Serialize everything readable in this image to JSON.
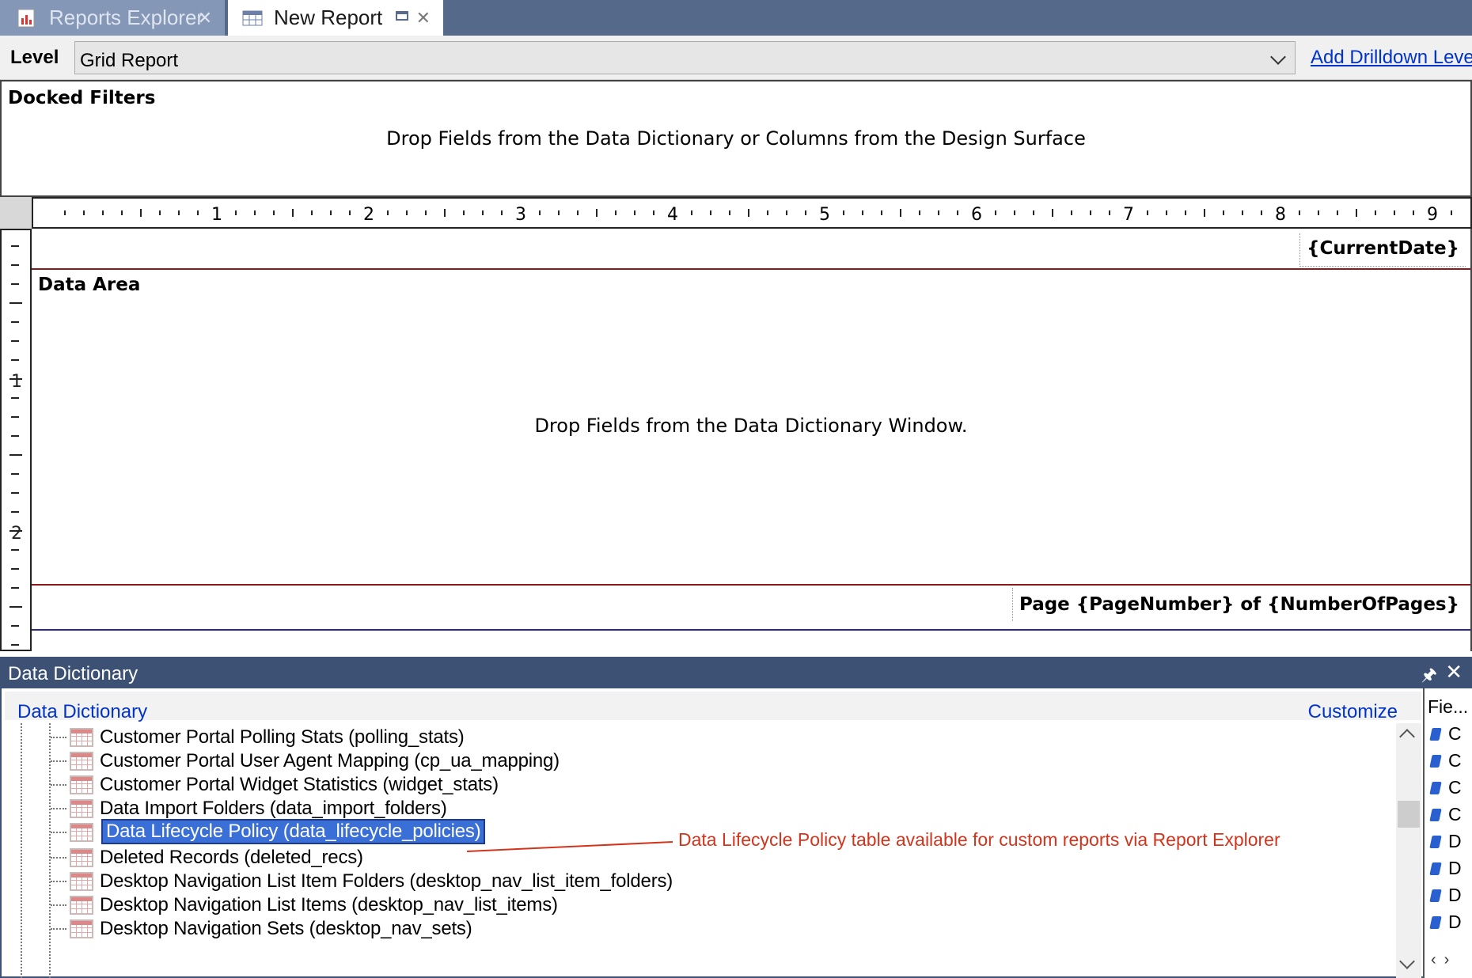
{
  "tabs": [
    {
      "label": "Reports Explorer",
      "active": false
    },
    {
      "label": "New Report",
      "active": true
    }
  ],
  "level_bar": {
    "label": "Level",
    "selected": "Grid Report",
    "add_drilldown": "Add Drilldown Level"
  },
  "docked_filters": {
    "title": "Docked Filters",
    "hint": "Drop Fields from the Data Dictionary or Columns from the Design Surface"
  },
  "ruler": {
    "horizontal": [
      "1",
      "2",
      "3",
      "4",
      "5",
      "6",
      "7",
      "8",
      "9"
    ],
    "vertical": [
      "1",
      "2"
    ]
  },
  "design_surface": {
    "current_date": "{CurrentDate}",
    "data_area_title": "Data Area",
    "data_area_hint": "Drop Fields from the Data Dictionary Window.",
    "page_footer": "Page {PageNumber} of {NumberOfPages}"
  },
  "data_dictionary": {
    "pane_title": "Data Dictionary",
    "link": "Data Dictionary",
    "customize": "Customize",
    "items": [
      {
        "label": "Customer Portal Polling Stats (polling_stats)",
        "selected": false
      },
      {
        "label": "Customer Portal User Agent Mapping (cp_ua_mapping)",
        "selected": false
      },
      {
        "label": "Customer Portal Widget Statistics (widget_stats)",
        "selected": false
      },
      {
        "label": "Data Import Folders (data_import_folders)",
        "selected": false
      },
      {
        "label": "Data Lifecycle Policy (data_lifecycle_policies)",
        "selected": true
      },
      {
        "label": "Deleted Records (deleted_recs)",
        "selected": false
      },
      {
        "label": "Desktop Navigation List Item Folders (desktop_nav_list_item_folders)",
        "selected": false
      },
      {
        "label": "Desktop Navigation List Items (desktop_nav_list_items)",
        "selected": false
      },
      {
        "label": "Desktop Navigation Sets (desktop_nav_sets)",
        "selected": false
      }
    ]
  },
  "fields_pane": {
    "header": "Fie...",
    "items": [
      "C",
      "C",
      "C",
      "C",
      "D",
      "D",
      "D",
      "D"
    ]
  },
  "annotation": "Data Lifecycle Policy table available for custom reports via Report Explorer",
  "colors": {
    "tab_strip": "#55698a",
    "pane_header": "#3c5174",
    "selection": "#3b6fd8",
    "annotation": "#d2341c",
    "band_line": "#8b1a1a"
  }
}
